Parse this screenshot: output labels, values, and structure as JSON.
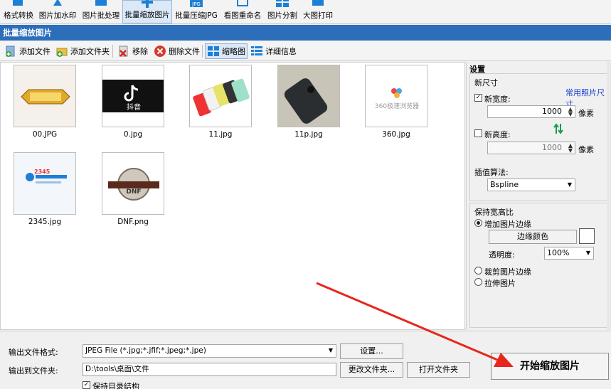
{
  "topbar": {
    "items": [
      {
        "label": "格式转换",
        "icon": "format-convert-icon"
      },
      {
        "label": "图片加水印",
        "icon": "watermark-icon"
      },
      {
        "label": "图片批处理",
        "icon": "batch-process-icon"
      },
      {
        "label": "批量缩放图片",
        "icon": "batch-resize-icon"
      },
      {
        "label": "批量压缩JPG",
        "icon": "compress-jpg-icon",
        "badge": "JPG"
      },
      {
        "label": "看图重命名",
        "icon": "rename-icon"
      },
      {
        "label": "图片分割",
        "icon": "split-icon"
      },
      {
        "label": "大图打印",
        "icon": "print-icon"
      }
    ]
  },
  "title": "批量缩放图片",
  "toolbar": {
    "add_file": "添加文件",
    "add_folder": "添加文件夹",
    "remove": "移除",
    "delete_file": "删除文件",
    "thumbnail": "缩略图",
    "details": "详细信息"
  },
  "thumbnails": [
    {
      "name": "00.JPG"
    },
    {
      "name": "0.jpg",
      "overlay": "抖音"
    },
    {
      "name": "11.jpg"
    },
    {
      "name": "11p.jpg"
    },
    {
      "name": "360.jpg",
      "overlay": "360极速浏览器"
    },
    {
      "name": "2345.jpg",
      "overlay": "2345"
    },
    {
      "name": "DNF.png",
      "overlay": "DNF"
    }
  ],
  "settings": {
    "title": "设置",
    "new_size": "新尺寸",
    "common_sizes_link": "常用照片尺寸",
    "new_width_label": "新宽度:",
    "new_width_checked": true,
    "new_width_value": "1000",
    "new_height_label": "新高度:",
    "new_height_checked": false,
    "new_height_value": "1000",
    "unit": "像素",
    "interp_label": "插值算法:",
    "interp_value": "Bspline",
    "keep_ratio_title": "保持宽高比",
    "opt_add_border": "增加图片边缘",
    "border_color_btn": "边缘颜色",
    "opacity_label": "透明度:",
    "opacity_value": "100%",
    "opt_crop": "裁剪图片边缘",
    "opt_stretch": "拉伸图片",
    "selected_option": "add_border"
  },
  "output": {
    "format_label": "输出文件格式:",
    "format_value": "JPEG File (*.jpg;*.jfif;*.jpeg;*.jpe)",
    "settings_btn": "设置...",
    "folder_label": "输出到文件夹:",
    "folder_value": "D:\\tools\\桌面\\文件",
    "change_folder_btn": "更改文件夹...",
    "open_folder_btn": "打开文件夹",
    "keep_dir_label": "保持目录结构",
    "keep_dir_checked": true,
    "start_btn": "开始缩放图片"
  },
  "colors": {
    "title_bar": "#2d6eba",
    "annotation_arrow": "#e8261c",
    "link": "#1a3fd0"
  }
}
